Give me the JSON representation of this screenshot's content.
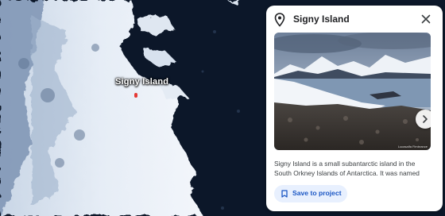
{
  "map": {
    "place_label": "Signy Island"
  },
  "card": {
    "title": "Signy Island",
    "description": "Signy Island is a small subantarctic island in the South Orkney Islands of Antarctica. It was named",
    "save_label": "Save to project",
    "photo_credit": "Lucasalfa Fimbrance",
    "icons": {
      "place": "place-pin-icon",
      "close": "close-icon",
      "next": "chevron-right-icon",
      "save": "bookmark-icon"
    }
  },
  "colors": {
    "card_background": "#ffffff",
    "save_button_bg": "#e8f0fe",
    "save_button_text": "#1a56c4",
    "pin": "#e53935"
  }
}
